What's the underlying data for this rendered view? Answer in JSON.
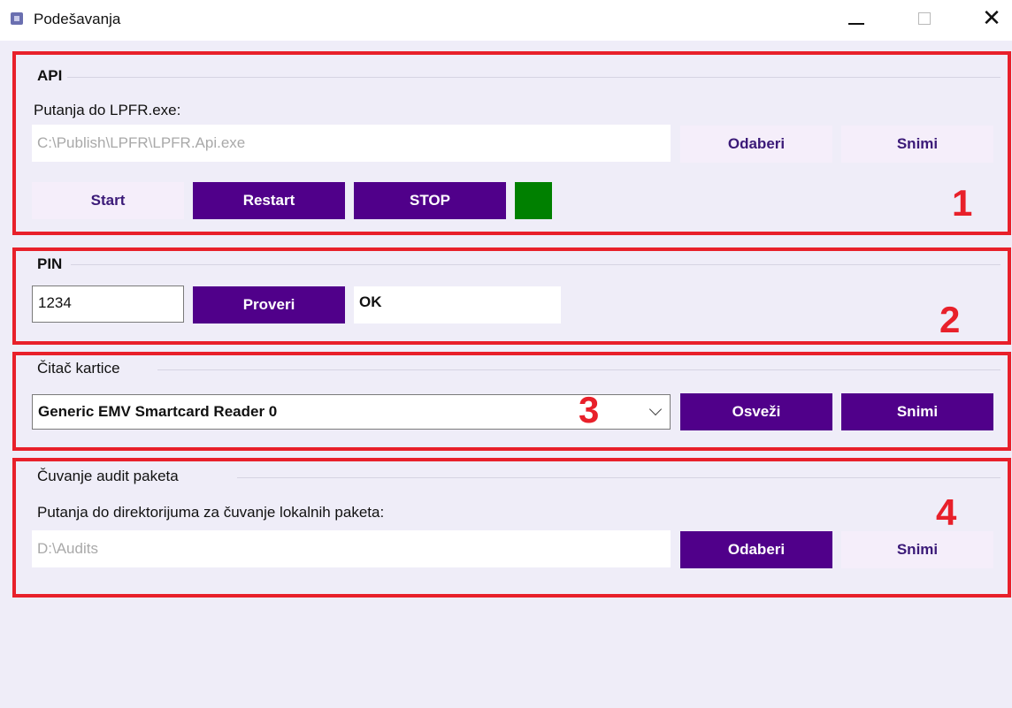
{
  "window": {
    "title": "Podešavanja",
    "minimize_icon": "minimize-icon",
    "maximize_icon": "maximize-icon",
    "close_glyph": "✕"
  },
  "api": {
    "legend": "API",
    "path_label": "Putanja do LPFR.exe:",
    "path_value": "C:\\Publish\\LPFR\\LPFR.Api.exe",
    "choose_label": "Odaberi",
    "save_label": "Snimi",
    "start_label": "Start",
    "restart_label": "Restart",
    "stop_label": "STOP",
    "status_color": "#008000",
    "marker": "1"
  },
  "pin": {
    "legend": "PIN",
    "value": "1234",
    "check_label": "Proveri",
    "result": "OK",
    "marker": "2"
  },
  "card_reader": {
    "legend": "Čitač kartice",
    "selected": "Generic EMV Smartcard Reader 0",
    "refresh_label": "Osveži",
    "save_label": "Snimi",
    "marker": "3"
  },
  "audit": {
    "legend": "Čuvanje audit paketa",
    "path_label": "Putanja do direktorijuma za čuvanje lokalnih paketa:",
    "path_value": "D:\\Audits",
    "choose_label": "Odaberi",
    "save_label": "Snimi",
    "marker": "4"
  },
  "colors": {
    "accent": "#50008a",
    "light_button": "#f5eefa",
    "highlight_border": "#e8202a"
  }
}
